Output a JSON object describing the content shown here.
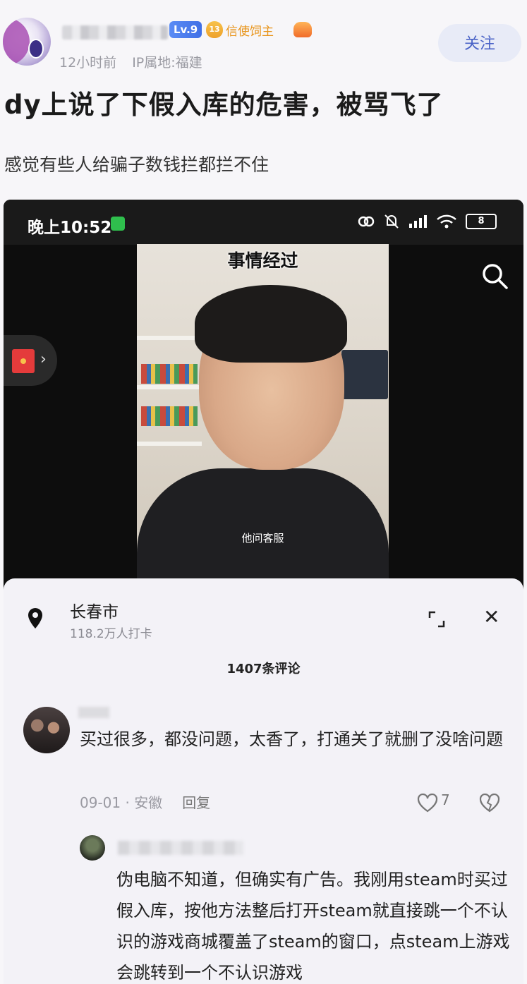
{
  "post": {
    "level_badge": "Lv.9",
    "fan_level": "13",
    "fan_badge_label": "信使饲主",
    "time_ago": "12小时前",
    "ip_location": "IP属地:福建",
    "follow_label": "关注",
    "title": "dy上说了下假入库的危害，被骂飞了",
    "body": "感觉有些人给骗子数钱拦都拦不住"
  },
  "phone": {
    "status_time": "晚上10:52",
    "battery": "8",
    "video_title": "事情经过",
    "video_subtitle": "他问客服"
  },
  "comments_sheet": {
    "location_name": "长春市",
    "location_checkins": "118.2万人打卡",
    "comment_count": "1407条评论",
    "comment": {
      "text": "买过很多，都没问题，太香了，打通关了就删了没啥问题",
      "date_place": "09-01 · 安徽",
      "reply_label": "回复",
      "likes": "7"
    },
    "reply": {
      "text": "伪电脑不知道，但确实有广告。我刚用steam时买过假入库，按他方法整后打开steam就直接跳一个不认识的游戏商城覆盖了steam的窗口，点steam上游戏会跳转到一个不认识游戏"
    }
  },
  "colors": {
    "accent": "#4a63c7",
    "follow_bg": "#e8ebf7",
    "level_badge": "#3f6fe6",
    "fan_badge": "#e8941a"
  }
}
